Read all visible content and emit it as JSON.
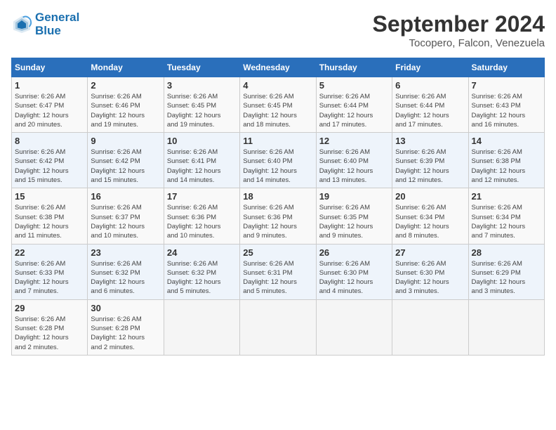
{
  "header": {
    "logo_line1": "General",
    "logo_line2": "Blue",
    "month": "September 2024",
    "location": "Tocopero, Falcon, Venezuela"
  },
  "weekdays": [
    "Sunday",
    "Monday",
    "Tuesday",
    "Wednesday",
    "Thursday",
    "Friday",
    "Saturday"
  ],
  "weeks": [
    [
      {
        "day": "1",
        "info": "Sunrise: 6:26 AM\nSunset: 6:47 PM\nDaylight: 12 hours\nand 20 minutes."
      },
      {
        "day": "2",
        "info": "Sunrise: 6:26 AM\nSunset: 6:46 PM\nDaylight: 12 hours\nand 19 minutes."
      },
      {
        "day": "3",
        "info": "Sunrise: 6:26 AM\nSunset: 6:45 PM\nDaylight: 12 hours\nand 19 minutes."
      },
      {
        "day": "4",
        "info": "Sunrise: 6:26 AM\nSunset: 6:45 PM\nDaylight: 12 hours\nand 18 minutes."
      },
      {
        "day": "5",
        "info": "Sunrise: 6:26 AM\nSunset: 6:44 PM\nDaylight: 12 hours\nand 17 minutes."
      },
      {
        "day": "6",
        "info": "Sunrise: 6:26 AM\nSunset: 6:44 PM\nDaylight: 12 hours\nand 17 minutes."
      },
      {
        "day": "7",
        "info": "Sunrise: 6:26 AM\nSunset: 6:43 PM\nDaylight: 12 hours\nand 16 minutes."
      }
    ],
    [
      {
        "day": "8",
        "info": "Sunrise: 6:26 AM\nSunset: 6:42 PM\nDaylight: 12 hours\nand 15 minutes."
      },
      {
        "day": "9",
        "info": "Sunrise: 6:26 AM\nSunset: 6:42 PM\nDaylight: 12 hours\nand 15 minutes."
      },
      {
        "day": "10",
        "info": "Sunrise: 6:26 AM\nSunset: 6:41 PM\nDaylight: 12 hours\nand 14 minutes."
      },
      {
        "day": "11",
        "info": "Sunrise: 6:26 AM\nSunset: 6:40 PM\nDaylight: 12 hours\nand 14 minutes."
      },
      {
        "day": "12",
        "info": "Sunrise: 6:26 AM\nSunset: 6:40 PM\nDaylight: 12 hours\nand 13 minutes."
      },
      {
        "day": "13",
        "info": "Sunrise: 6:26 AM\nSunset: 6:39 PM\nDaylight: 12 hours\nand 12 minutes."
      },
      {
        "day": "14",
        "info": "Sunrise: 6:26 AM\nSunset: 6:38 PM\nDaylight: 12 hours\nand 12 minutes."
      }
    ],
    [
      {
        "day": "15",
        "info": "Sunrise: 6:26 AM\nSunset: 6:38 PM\nDaylight: 12 hours\nand 11 minutes."
      },
      {
        "day": "16",
        "info": "Sunrise: 6:26 AM\nSunset: 6:37 PM\nDaylight: 12 hours\nand 10 minutes."
      },
      {
        "day": "17",
        "info": "Sunrise: 6:26 AM\nSunset: 6:36 PM\nDaylight: 12 hours\nand 10 minutes."
      },
      {
        "day": "18",
        "info": "Sunrise: 6:26 AM\nSunset: 6:36 PM\nDaylight: 12 hours\nand 9 minutes."
      },
      {
        "day": "19",
        "info": "Sunrise: 6:26 AM\nSunset: 6:35 PM\nDaylight: 12 hours\nand 9 minutes."
      },
      {
        "day": "20",
        "info": "Sunrise: 6:26 AM\nSunset: 6:34 PM\nDaylight: 12 hours\nand 8 minutes."
      },
      {
        "day": "21",
        "info": "Sunrise: 6:26 AM\nSunset: 6:34 PM\nDaylight: 12 hours\nand 7 minutes."
      }
    ],
    [
      {
        "day": "22",
        "info": "Sunrise: 6:26 AM\nSunset: 6:33 PM\nDaylight: 12 hours\nand 7 minutes."
      },
      {
        "day": "23",
        "info": "Sunrise: 6:26 AM\nSunset: 6:32 PM\nDaylight: 12 hours\nand 6 minutes."
      },
      {
        "day": "24",
        "info": "Sunrise: 6:26 AM\nSunset: 6:32 PM\nDaylight: 12 hours\nand 5 minutes."
      },
      {
        "day": "25",
        "info": "Sunrise: 6:26 AM\nSunset: 6:31 PM\nDaylight: 12 hours\nand 5 minutes."
      },
      {
        "day": "26",
        "info": "Sunrise: 6:26 AM\nSunset: 6:30 PM\nDaylight: 12 hours\nand 4 minutes."
      },
      {
        "day": "27",
        "info": "Sunrise: 6:26 AM\nSunset: 6:30 PM\nDaylight: 12 hours\nand 3 minutes."
      },
      {
        "day": "28",
        "info": "Sunrise: 6:26 AM\nSunset: 6:29 PM\nDaylight: 12 hours\nand 3 minutes."
      }
    ],
    [
      {
        "day": "29",
        "info": "Sunrise: 6:26 AM\nSunset: 6:28 PM\nDaylight: 12 hours\nand 2 minutes."
      },
      {
        "day": "30",
        "info": "Sunrise: 6:26 AM\nSunset: 6:28 PM\nDaylight: 12 hours\nand 2 minutes."
      },
      {
        "day": "",
        "info": ""
      },
      {
        "day": "",
        "info": ""
      },
      {
        "day": "",
        "info": ""
      },
      {
        "day": "",
        "info": ""
      },
      {
        "day": "",
        "info": ""
      }
    ]
  ]
}
